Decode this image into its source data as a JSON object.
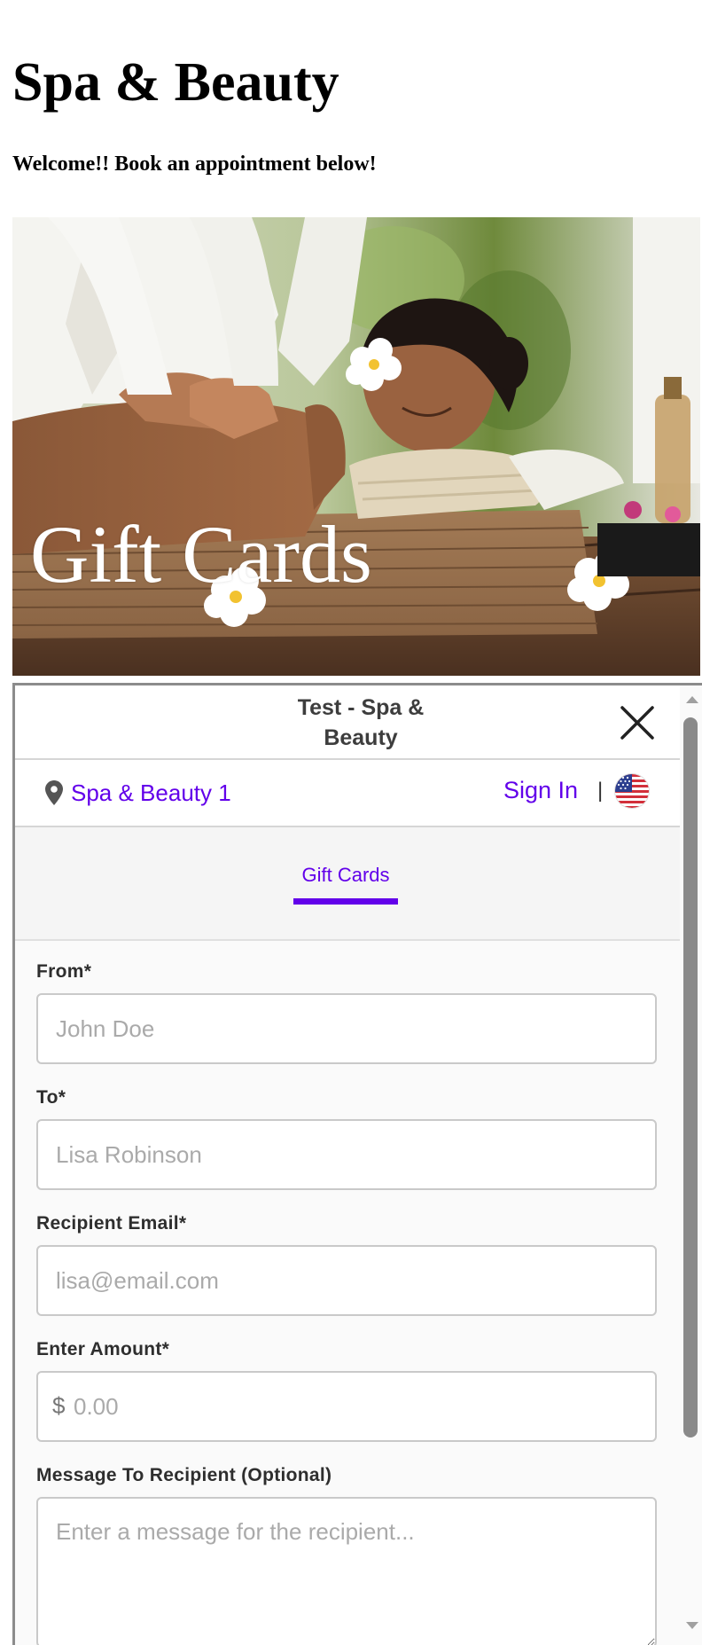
{
  "page": {
    "title": "Spa & Beauty",
    "welcome": "Welcome!! Book an appointment below!"
  },
  "hero": {
    "caption": "Gift Cards"
  },
  "widget": {
    "title": "Test - Spa & Beauty",
    "location": "Spa & Beauty 1",
    "sign_in": "Sign In",
    "separator": "|",
    "tab": "Gift Cards",
    "accent_color": "#6200ea"
  },
  "form": {
    "from": {
      "label": "From*",
      "placeholder": "John Doe"
    },
    "to": {
      "label": "To*",
      "placeholder": "Lisa Robinson"
    },
    "email": {
      "label": "Recipient Email*",
      "placeholder": "lisa@email.com"
    },
    "amount": {
      "label": "Enter Amount*",
      "currency": "$",
      "placeholder": "0.00"
    },
    "message": {
      "label": "Message To Recipient (Optional)",
      "placeholder": "Enter a message for the recipient..."
    }
  }
}
